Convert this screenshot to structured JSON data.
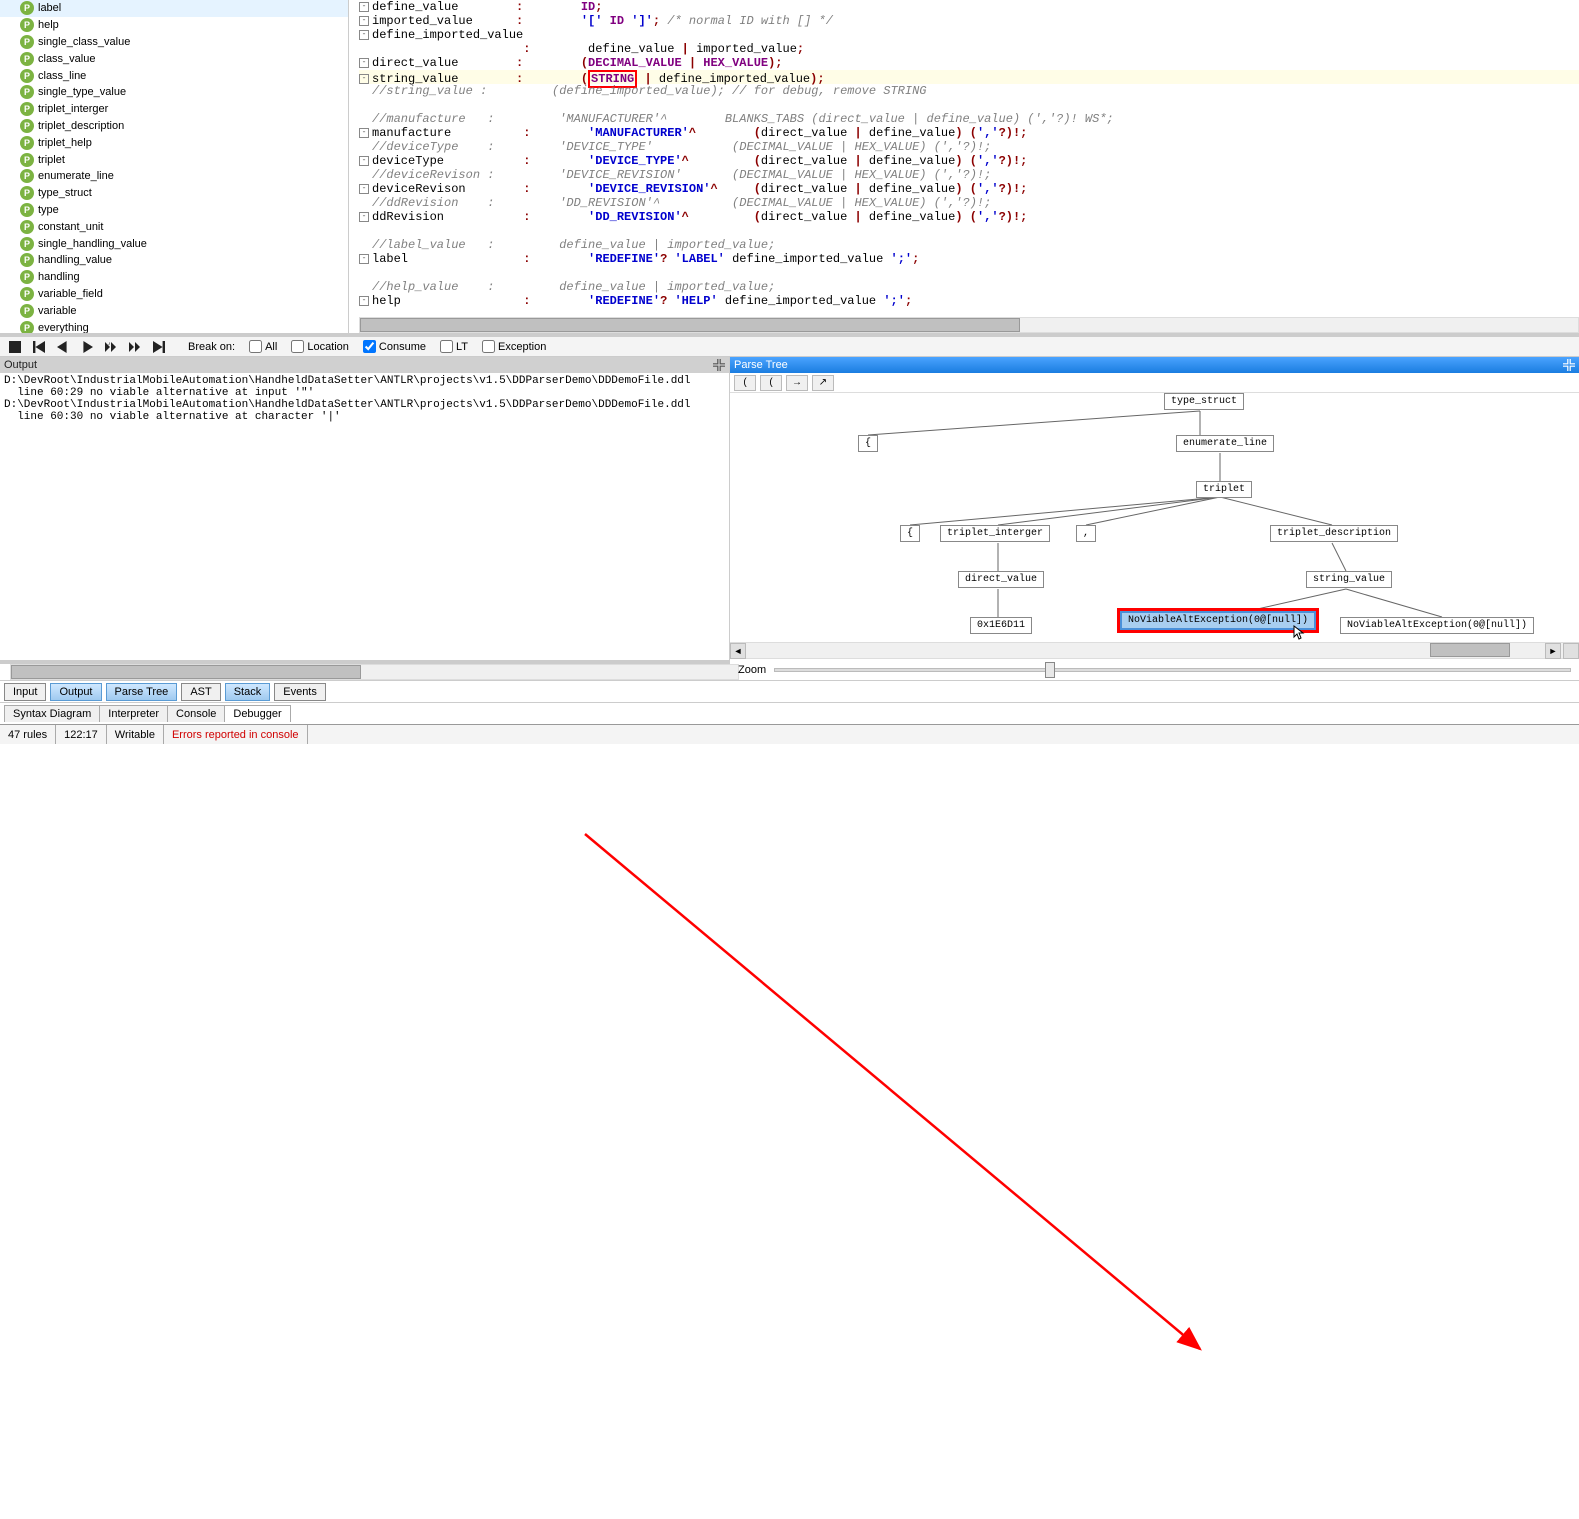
{
  "outline": {
    "items": [
      "label",
      "help",
      "single_class_value",
      "class_value",
      "class_line",
      "single_type_value",
      "triplet_interger",
      "triplet_description",
      "triplet_help",
      "triplet",
      "enumerate_line",
      "type_struct",
      "type",
      "constant_unit",
      "single_handling_value",
      "handling_value",
      "handling",
      "variable_field",
      "variable",
      "everything"
    ],
    "icon_label": "P"
  },
  "code_lines": [
    {
      "fold": "-",
      "t": [
        {
          "c": "kw",
          "s": "define_value"
        },
        "        ",
        {
          "c": "op",
          "s": ":"
        },
        "        ",
        {
          "c": "id",
          "s": "ID"
        },
        {
          "c": "op",
          "s": ";"
        }
      ]
    },
    {
      "fold": "-",
      "t": [
        {
          "c": "kw",
          "s": "imported_value"
        },
        "      ",
        {
          "c": "op",
          "s": ":"
        },
        "        ",
        {
          "c": "str",
          "s": "'['"
        },
        " ",
        {
          "c": "id",
          "s": "ID"
        },
        " ",
        {
          "c": "str",
          "s": "']'"
        },
        {
          "c": "op",
          "s": ";"
        },
        " ",
        {
          "c": "comment",
          "s": "/* normal ID with [] */"
        }
      ]
    },
    {
      "fold": "-",
      "t": [
        {
          "c": "kw",
          "s": "define_imported_value"
        }
      ]
    },
    {
      "fold": " ",
      "t": [
        "                     ",
        {
          "c": "op",
          "s": ":"
        },
        "        ",
        "define_value ",
        {
          "c": "op",
          "s": "|"
        },
        " imported_value",
        {
          "c": "op",
          "s": ";"
        }
      ]
    },
    {
      "fold": "-",
      "t": [
        {
          "c": "kw",
          "s": "direct_value"
        },
        "        ",
        {
          "c": "op",
          "s": ":"
        },
        "        ",
        {
          "c": "op",
          "s": "("
        },
        {
          "c": "id",
          "s": "DECIMAL_VALUE"
        },
        " ",
        {
          "c": "op",
          "s": "|"
        },
        " ",
        {
          "c": "id",
          "s": "HEX_VALUE"
        },
        {
          "c": "op",
          "s": ")"
        },
        {
          "c": "op",
          "s": ";"
        }
      ]
    },
    {
      "hl": true,
      "fold": "-",
      "t": [
        {
          "c": "kw",
          "s": "string_value"
        },
        "        ",
        {
          "c": "op",
          "s": ":"
        },
        "        ",
        {
          "c": "op",
          "s": "("
        },
        {
          "box": true,
          "c": "id",
          "s": "STRING"
        },
        " ",
        {
          "c": "op",
          "s": "|"
        },
        " define_imported_value",
        {
          "c": "op",
          "s": ")"
        },
        {
          "c": "op",
          "s": ";"
        }
      ]
    },
    {
      "fold": " ",
      "t": [
        {
          "c": "comment",
          "s": "//string_value :         (define_imported_value); // for debug, remove STRING"
        }
      ]
    },
    {
      "fold": " ",
      "t": [
        ""
      ]
    },
    {
      "fold": " ",
      "t": [
        {
          "c": "comment",
          "s": "//manufacture   :         'MANUFACTURER'^        BLANKS_TABS (direct_value | define_value) (','?)! WS*;"
        }
      ]
    },
    {
      "fold": "-",
      "t": [
        {
          "c": "kw",
          "s": "manufacture"
        },
        "          ",
        {
          "c": "op",
          "s": ":"
        },
        "        ",
        {
          "c": "str",
          "s": "'MANUFACTURER'"
        },
        {
          "c": "op",
          "s": "^"
        },
        "        ",
        {
          "c": "op",
          "s": "("
        },
        "direct_value ",
        {
          "c": "op",
          "s": "|"
        },
        " define_value",
        {
          "c": "op",
          "s": ")"
        },
        " ",
        {
          "c": "op",
          "s": "("
        },
        {
          "c": "str",
          "s": "','"
        },
        {
          "c": "op",
          "s": "?"
        },
        {
          "c": "op",
          "s": ")"
        },
        {
          "c": "op",
          "s": "!"
        },
        {
          "c": "op",
          "s": ";"
        }
      ]
    },
    {
      "fold": " ",
      "t": [
        {
          "c": "comment",
          "s": "//deviceType    :         'DEVICE_TYPE'           (DECIMAL_VALUE | HEX_VALUE) (','?)!;"
        }
      ]
    },
    {
      "fold": "-",
      "t": [
        {
          "c": "kw",
          "s": "deviceType"
        },
        "           ",
        {
          "c": "op",
          "s": ":"
        },
        "        ",
        {
          "c": "str",
          "s": "'DEVICE_TYPE'"
        },
        {
          "c": "op",
          "s": "^"
        },
        "         ",
        {
          "c": "op",
          "s": "("
        },
        "direct_value ",
        {
          "c": "op",
          "s": "|"
        },
        " define_value",
        {
          "c": "op",
          "s": ")"
        },
        " ",
        {
          "c": "op",
          "s": "("
        },
        {
          "c": "str",
          "s": "','"
        },
        {
          "c": "op",
          "s": "?"
        },
        {
          "c": "op",
          "s": ")"
        },
        {
          "c": "op",
          "s": "!"
        },
        {
          "c": "op",
          "s": ";"
        }
      ]
    },
    {
      "fold": " ",
      "t": [
        {
          "c": "comment",
          "s": "//deviceRevison :         'DEVICE_REVISION'       (DECIMAL_VALUE | HEX_VALUE) (','?)!;"
        }
      ]
    },
    {
      "fold": "-",
      "t": [
        {
          "c": "kw",
          "s": "deviceRevison"
        },
        "        ",
        {
          "c": "op",
          "s": ":"
        },
        "        ",
        {
          "c": "str",
          "s": "'DEVICE_REVISION'"
        },
        {
          "c": "op",
          "s": "^"
        },
        "     ",
        {
          "c": "op",
          "s": "("
        },
        "direct_value ",
        {
          "c": "op",
          "s": "|"
        },
        " define_value",
        {
          "c": "op",
          "s": ")"
        },
        " ",
        {
          "c": "op",
          "s": "("
        },
        {
          "c": "str",
          "s": "','"
        },
        {
          "c": "op",
          "s": "?"
        },
        {
          "c": "op",
          "s": ")"
        },
        {
          "c": "op",
          "s": "!"
        },
        {
          "c": "op",
          "s": ";"
        }
      ]
    },
    {
      "fold": " ",
      "t": [
        {
          "c": "comment",
          "s": "//ddRevision    :         'DD_REVISION'^          (DECIMAL_VALUE | HEX_VALUE) (','?)!;"
        }
      ]
    },
    {
      "fold": "-",
      "t": [
        {
          "c": "kw",
          "s": "ddRevision"
        },
        "           ",
        {
          "c": "op",
          "s": ":"
        },
        "        ",
        {
          "c": "str",
          "s": "'DD_REVISION'"
        },
        {
          "c": "op",
          "s": "^"
        },
        "         ",
        {
          "c": "op",
          "s": "("
        },
        "direct_value ",
        {
          "c": "op",
          "s": "|"
        },
        " define_value",
        {
          "c": "op",
          "s": ")"
        },
        " ",
        {
          "c": "op",
          "s": "("
        },
        {
          "c": "str",
          "s": "','"
        },
        {
          "c": "op",
          "s": "?"
        },
        {
          "c": "op",
          "s": ")"
        },
        {
          "c": "op",
          "s": "!"
        },
        {
          "c": "op",
          "s": ";"
        }
      ]
    },
    {
      "fold": " ",
      "t": [
        ""
      ]
    },
    {
      "fold": " ",
      "t": [
        {
          "c": "comment",
          "s": "//label_value   :         define_value | imported_value;"
        }
      ]
    },
    {
      "fold": "-",
      "t": [
        {
          "c": "kw",
          "s": "label"
        },
        "                ",
        {
          "c": "op",
          "s": ":"
        },
        "        ",
        {
          "c": "str",
          "s": "'REDEFINE'"
        },
        {
          "c": "op",
          "s": "?"
        },
        " ",
        {
          "c": "str",
          "s": "'LABEL'"
        },
        " define_imported_value ",
        {
          "c": "str",
          "s": "';'"
        },
        {
          "c": "op",
          "s": ";"
        }
      ]
    },
    {
      "fold": " ",
      "t": [
        ""
      ]
    },
    {
      "fold": " ",
      "t": [
        {
          "c": "comment",
          "s": "//help_value    :         define_value | imported_value;"
        }
      ]
    },
    {
      "fold": "-",
      "t": [
        {
          "c": "kw",
          "s": "help"
        },
        "                 ",
        {
          "c": "op",
          "s": ":"
        },
        "        ",
        {
          "c": "str",
          "s": "'REDEFINE'"
        },
        {
          "c": "op",
          "s": "?"
        },
        " ",
        {
          "c": "str",
          "s": "'HELP'"
        },
        " define_imported_value ",
        {
          "c": "str",
          "s": "';'"
        },
        {
          "c": "op",
          "s": ";"
        }
      ]
    }
  ],
  "toolbar": {
    "break_on": "Break on:",
    "chk_all": "All",
    "chk_location": "Location",
    "chk_consume": "Consume",
    "chk_lt": "LT",
    "chk_exception": "Exception"
  },
  "output": {
    "title": "Output",
    "lines": [
      "D:\\DevRoot\\IndustrialMobileAutomation\\HandheldDataSetter\\ANTLR\\projects\\v1.5\\DDParserDemo\\DDDemoFile.ddl",
      "  line 60:29 no viable alternative at input '\"'",
      "D:\\DevRoot\\IndustrialMobileAutomation\\HandheldDataSetter\\ANTLR\\projects\\v1.5\\DDParserDemo\\DDDemoFile.ddl",
      "  line 60:30 no viable alternative at character '|'"
    ]
  },
  "parsetree": {
    "title": "Parse Tree",
    "tb": [
      "(",
      "(",
      "→",
      "↗"
    ],
    "nodes": {
      "type_struct": "type_struct",
      "enumerate_line": "enumerate_line",
      "triplet": "triplet",
      "lbrace": "{",
      "lbrace2": "{",
      "triplet_interger": "triplet_interger",
      "comma": ",",
      "triplet_description": "triplet_description",
      "direct_value": "direct_value",
      "string_value": "string_value",
      "hex": "0x1E6D11",
      "nvae1": "NoViableAltException(0@[null])",
      "nvae2": "NoViableAltException(0@[null])"
    },
    "zoom_label": "Zoom"
  },
  "tabs1": {
    "input": "Input",
    "output": "Output",
    "parse_tree": "Parse Tree",
    "ast": "AST",
    "stack": "Stack",
    "events": "Events"
  },
  "tabs2": {
    "syntax": "Syntax Diagram",
    "interpreter": "Interpreter",
    "console": "Console",
    "debugger": "Debugger"
  },
  "status": {
    "rules": "47 rules",
    "pos": "122:17",
    "writable": "Writable",
    "errors": "Errors reported in console"
  }
}
